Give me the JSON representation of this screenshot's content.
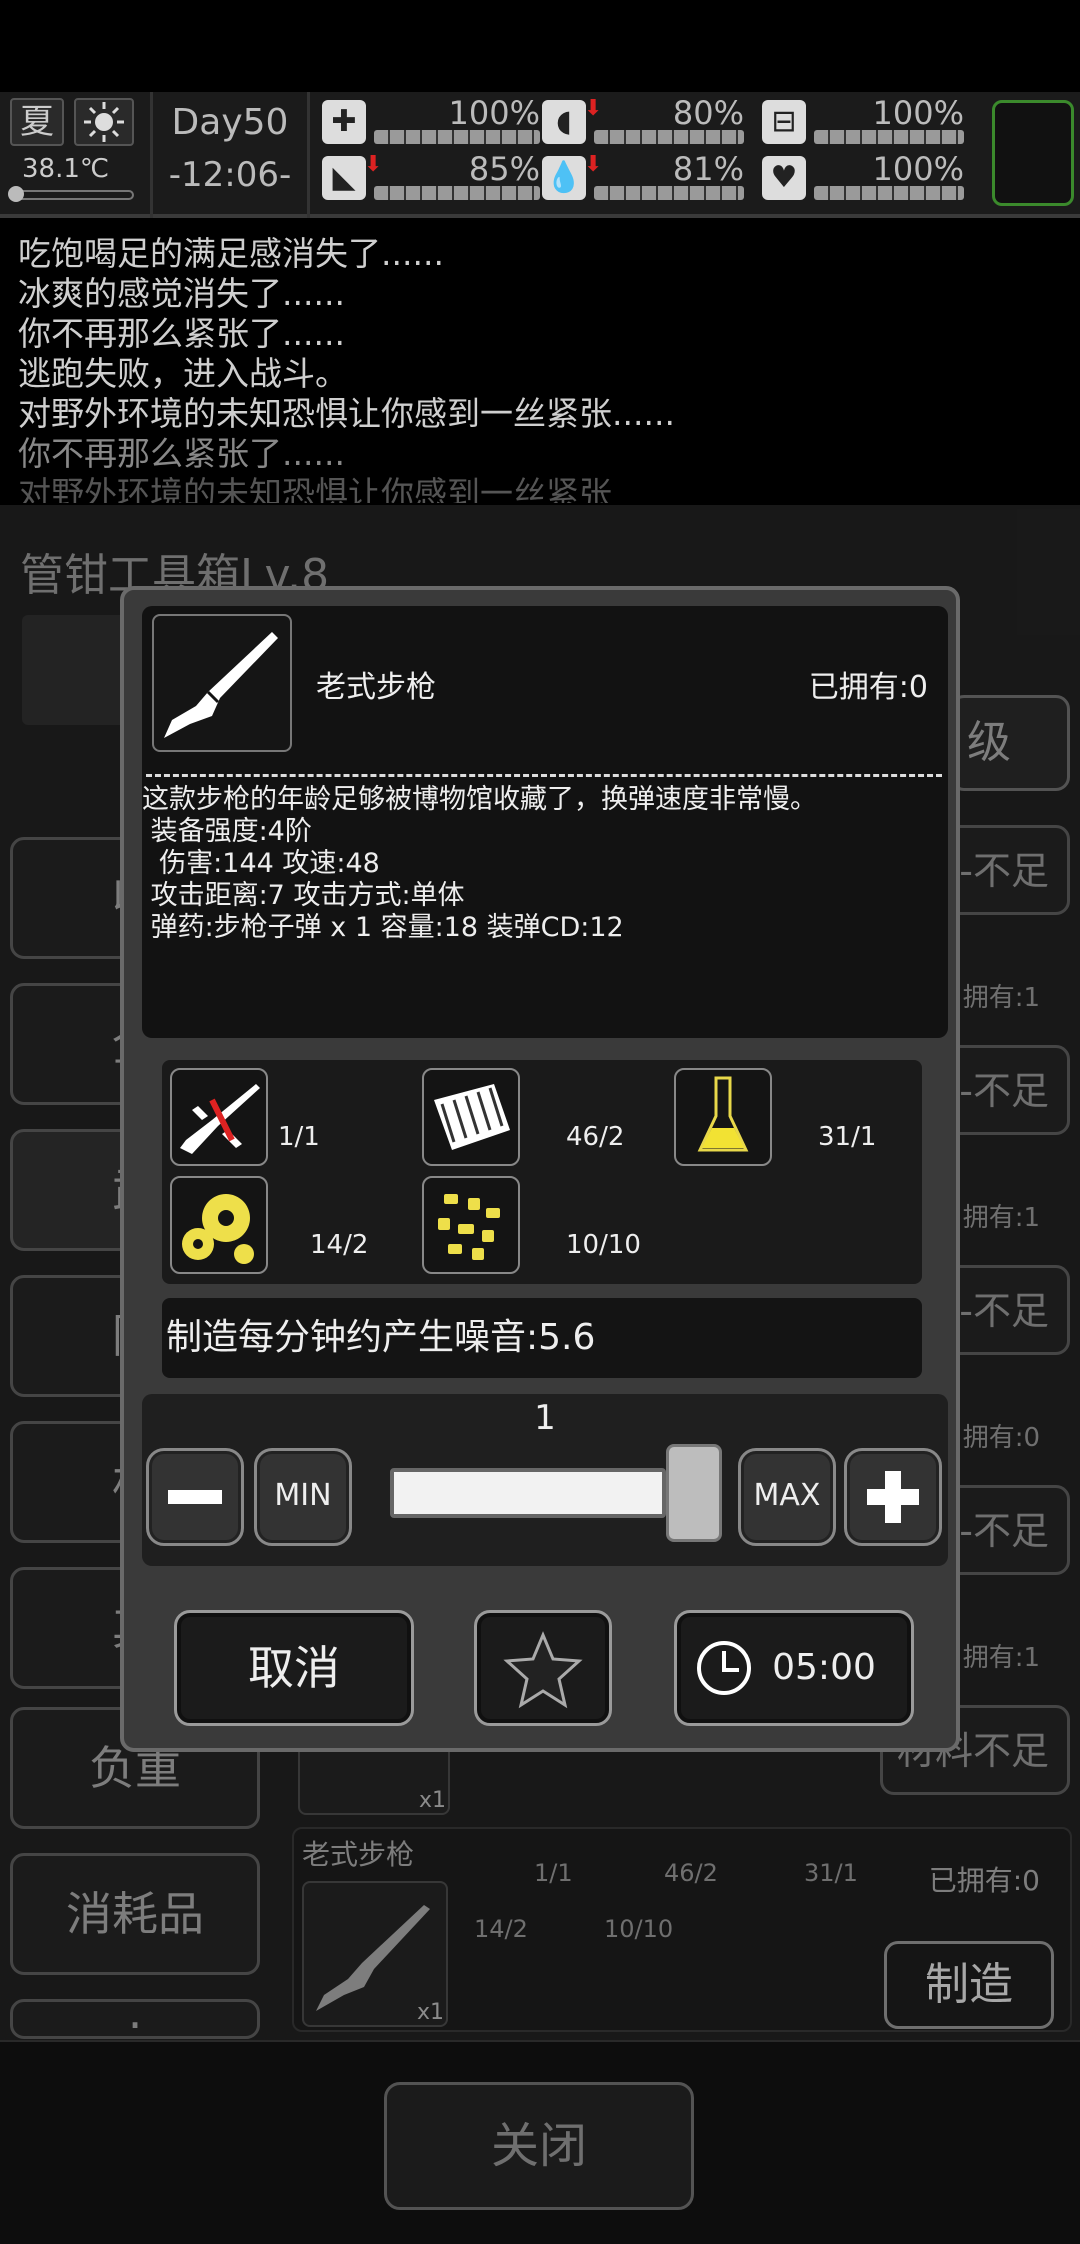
{
  "status": {
    "season": "夏",
    "temperature": "38.1℃",
    "day": "Day50",
    "clock": "-12:06-",
    "stats": [
      {
        "icon": "medkit-icon",
        "value": "100%"
      },
      {
        "icon": "stomach-icon",
        "value": "80%",
        "decreasing": true
      },
      {
        "icon": "pill-icon",
        "value": "100%"
      },
      {
        "icon": "boot-icon",
        "value": "85%",
        "decreasing": true
      },
      {
        "icon": "water-drop-icon",
        "value": "81%",
        "decreasing": true
      },
      {
        "icon": "heart-icon",
        "value": "100%"
      }
    ]
  },
  "log": [
    "吃饱喝足的满足感消失了......",
    "冰爽的感觉消失了......",
    "你不再那么紧张了......",
    "逃跑失败，进入战斗。",
    "对野外环境的未知恐惧让你感到一丝紧张......",
    "你不再那么紧张了......",
    "对野外环境的未知恐惧让你感到一丝紧张"
  ],
  "background": {
    "title": "管钳工具箱Lv.8",
    "upgrade_label": "级",
    "sidebar": [
      "收",
      "全",
      "武",
      "防",
      "材",
      "其",
      "负重",
      "消耗品",
      "."
    ],
    "right_labels": [
      "拥有:1",
      "拥有:1",
      "拥有:0",
      "拥有:1"
    ],
    "right_buttons": [
      "-不足",
      "-不足",
      "-不足",
      "-不足",
      "材料不足"
    ],
    "card": {
      "name": "老式步枪",
      "owned": "已拥有:0",
      "qty": "x1",
      "prev_qty": "x1",
      "materials": [
        "1/1",
        "46/2",
        "31/1",
        "14/2",
        "10/10"
      ],
      "make_label": "制造"
    },
    "close_label": "关闭"
  },
  "dialog": {
    "item_name": "老式步枪",
    "owned": "已拥有:0",
    "description": [
      "这款步枪的年龄足够被博物馆收藏了，换弹速度非常慢。",
      " 装备强度:4阶",
      "  伤害:144 攻速:48",
      " 攻击距离:7 攻击方式:单体",
      " 弹药:步枪子弹 x 1 容量:18 装弹CD:12"
    ],
    "materials": [
      {
        "icon": "rifle-parts-icon",
        "count": "1/1"
      },
      {
        "icon": "cloth-icon",
        "count": "46/2"
      },
      {
        "icon": "flask-icon",
        "count": "31/1"
      },
      {
        "icon": "gears-icon",
        "count": "14/2"
      },
      {
        "icon": "scrap-icon",
        "count": "10/10"
      }
    ],
    "noise": "制造每分钟约产生噪音:5.6",
    "quantity": "1",
    "min_label": "MIN",
    "max_label": "MAX",
    "cancel_label": "取消",
    "time_label": "05:00"
  }
}
